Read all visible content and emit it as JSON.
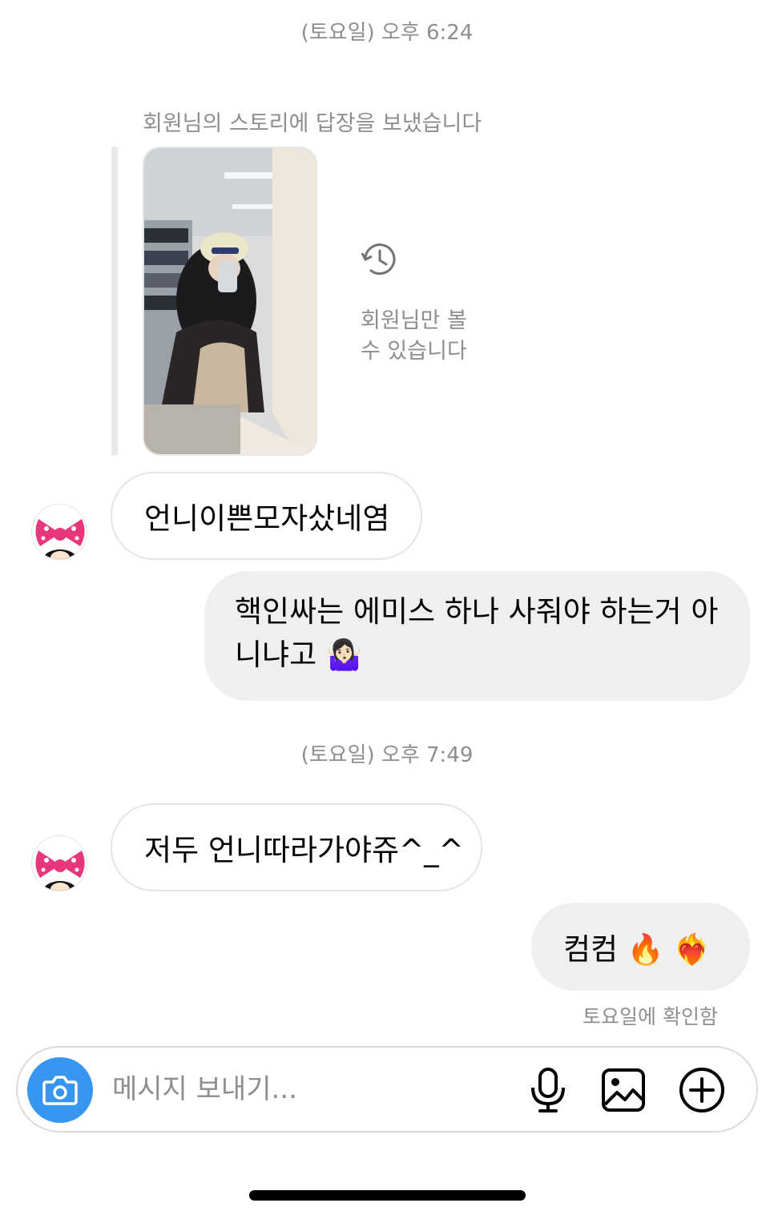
{
  "timestamps": [
    "(토요일) 오후 6:24",
    "(토요일) 오후 7:49"
  ],
  "story_reply": {
    "note": "회원님의 스토리에 답장을 보냈습니다",
    "expired_line1": "회원님만 볼",
    "expired_line2": "수 있습니다"
  },
  "messages": [
    {
      "from": "other",
      "text": "언니이쁜모자샀네염"
    },
    {
      "from": "me",
      "line1": "핵인싸는 에미스 하나 사줘야 하는거 아",
      "line2": "니냐고 🤷🏻‍♀️"
    },
    {
      "from": "other",
      "text": "저두 언니따라가야쥬^_^"
    },
    {
      "from": "me",
      "text": "컴컴 🔥 ❤️‍🔥"
    }
  ],
  "seen_status": "토요일에 확인함",
  "composer": {
    "placeholder": "메시지 보내기..."
  },
  "icons": [
    "history-icon",
    "minnie-bow-avatar",
    "camera-icon",
    "microphone-icon",
    "gallery-icon",
    "plus-circle-icon"
  ],
  "colors": {
    "accent": "#3797f0",
    "outgoing_bubble": "#efefef",
    "muted_text": "#8e8e8e",
    "bow": "#e8367d"
  }
}
